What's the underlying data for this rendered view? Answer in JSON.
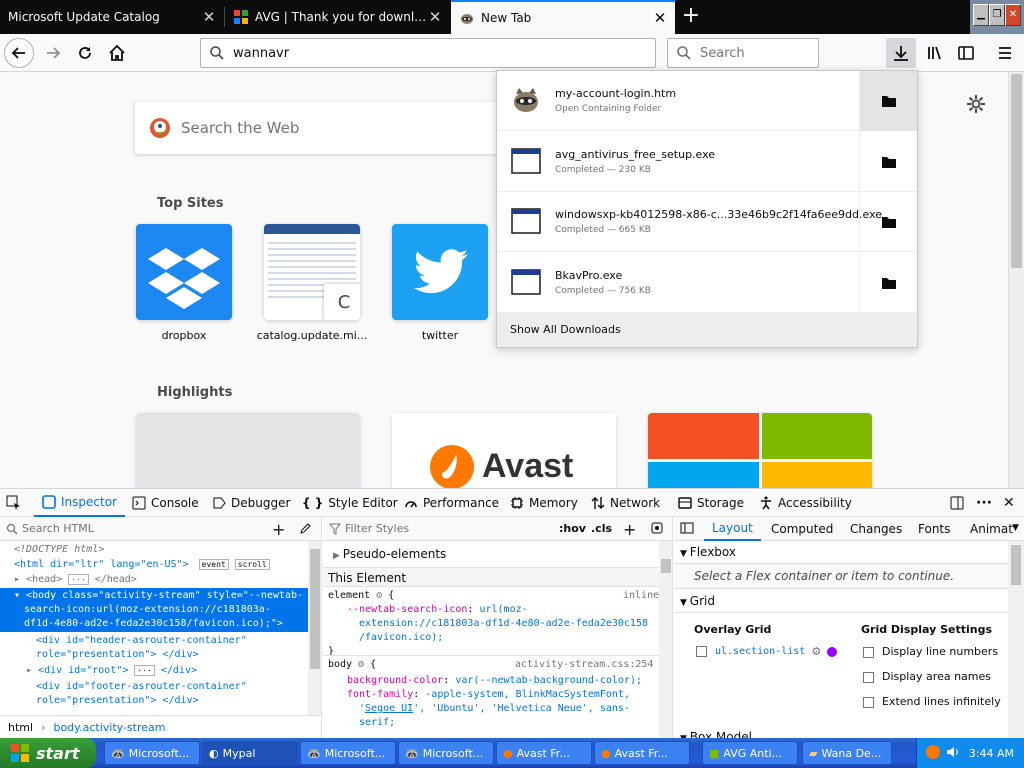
{
  "tabs": [
    {
      "title": "Microsoft Update Catalog"
    },
    {
      "title": "AVG | Thank you for downloading"
    },
    {
      "title": "New Tab"
    }
  ],
  "urlbar": {
    "value": "wannavr"
  },
  "searchbar": {
    "placeholder": "Search"
  },
  "newtab": {
    "search_placeholder": "Search the Web",
    "top_sites_title": "Top Sites",
    "highlights_title": "Highlights",
    "top_sites": [
      {
        "label": "dropbox"
      },
      {
        "label": "catalog.update.mi..."
      },
      {
        "label": "twitter"
      }
    ],
    "catalog_tile_letter": "C",
    "avast_brand": "Avast"
  },
  "downloads": {
    "items": [
      {
        "name": "my-account-login.htm",
        "status": "Open Containing Folder"
      },
      {
        "name": "avg_antivirus_free_setup.exe",
        "status": "Completed — 230 KB"
      },
      {
        "name": "windowsxp-kb4012598-x86-c...33e46b9c2f14fa6ee9dd.exe",
        "status": "Completed — 665 KB"
      },
      {
        "name": "BkavPro.exe",
        "status": "Completed — 756 KB"
      }
    ],
    "show_all": "Show All Downloads"
  },
  "devtools": {
    "tabs": [
      "Inspector",
      "Console",
      "Debugger",
      "Style Editor",
      "Performance",
      "Memory",
      "Network",
      "Storage",
      "Accessibility"
    ],
    "search_html_placeholder": "Search HTML",
    "filter_styles_placeholder": "Filter Styles",
    "hov": ":hov",
    "cls": ".cls",
    "markup": {
      "doctype": "<!DOCTYPE html>",
      "html_open": "<html dir=\"ltr\" lang=\"en-US\">",
      "badge_event": "event",
      "badge_scroll": "scroll",
      "head": "<head>",
      "head_close": "</head>",
      "body_line1": "<body class=\"activity-stream\" style=\"--newtab-",
      "body_line2": "search-icon:url(moz-extension://c181803a-",
      "body_line3": "df1d-4e80-ad2e-feda2e30c158/favicon.ico);\">",
      "div1_line1": "<div id=\"header-asrouter-container\"",
      "div1_line2": "role=\"presentation\"> </div>",
      "div2": "<div id=\"root\">",
      "div2_close": "</div>",
      "div3_line1": "<div id=\"footer-asrouter-container\"",
      "div3_line2": "role=\"presentation\"> </div>",
      "ellipsis": "···"
    },
    "breadcrumb": [
      "html",
      "body.activity-stream"
    ],
    "rules": {
      "pseudo": "Pseudo-elements",
      "this_element": "This Element",
      "element_sel": "element",
      "inline": "inline",
      "el_prop": "--newtab-search-icon",
      "el_val1": "url(moz-",
      "el_val2": "extension://c181803a-df1d-4e80-ad2e-feda2e30c158",
      "el_val3": "/favicon.ico);",
      "body_sel": "body",
      "body_src": "activity-stream.css:254",
      "bg_prop": "background-color",
      "bg_val": "var(--newtab-background-color);",
      "ff_prop": "font-family",
      "ff_val1": "-apple-system, BlinkMacSystemFont,",
      "ff_val2a": "Segoe UI",
      "ff_val2b": ", 'Ubuntu', 'Helvetica Neue', sans-",
      "ff_val3": "serif;"
    },
    "layout": {
      "tabs": [
        "Layout",
        "Computed",
        "Changes",
        "Fonts",
        "Animat"
      ],
      "flexbox": "Flexbox",
      "flex_hint": "Select a Flex container or item to continue.",
      "grid": "Grid",
      "overlay_grid": "Overlay Grid",
      "grid_item": "ul.section-list",
      "grid_settings": "Grid Display Settings",
      "settings": [
        "Display line numbers",
        "Display area names",
        "Extend lines infinitely"
      ],
      "box_model": "Box Model"
    }
  },
  "taskbar": {
    "start": "start",
    "tasks": [
      "Microsoft...",
      "Mypal",
      "Microsoft...",
      "Microsoft...",
      "Avast Fr...",
      "Avast Fr...",
      "AVG Anti...",
      "Wana De..."
    ],
    "clock": "3:44 AM"
  },
  "colors": {
    "accent": "#0a84ff",
    "selection": "#0074e8",
    "dropbox": "#1e88f2",
    "twitter": "#1da1f2",
    "avast": "#ff7800"
  }
}
